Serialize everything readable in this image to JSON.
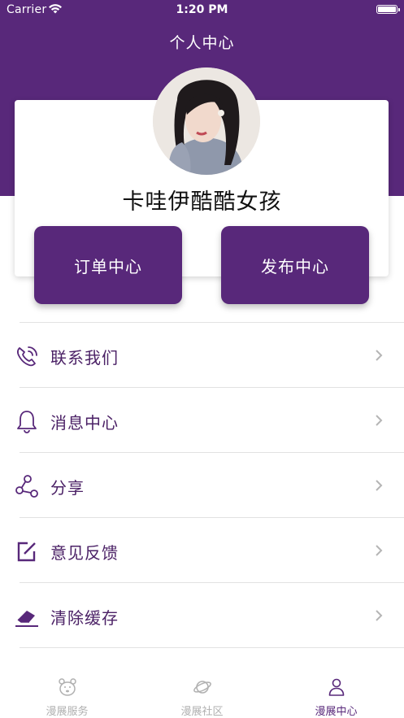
{
  "status_bar": {
    "carrier": "Carrier",
    "time": "1:20 PM"
  },
  "header": {
    "title": "个人中心"
  },
  "profile": {
    "username": "卡哇伊酷酷女孩"
  },
  "actions": {
    "orders": "订单中心",
    "publish": "发布中心"
  },
  "menu": {
    "items": [
      {
        "label": "联系我们",
        "icon": "phone-icon"
      },
      {
        "label": "消息中心",
        "icon": "bell-icon"
      },
      {
        "label": "分享",
        "icon": "share-icon"
      },
      {
        "label": "意见反馈",
        "icon": "feedback-icon"
      },
      {
        "label": "清除缓存",
        "icon": "eraser-icon"
      }
    ]
  },
  "tab_bar": {
    "tabs": [
      {
        "label": "漫展服务",
        "icon": "bear-icon",
        "active": false
      },
      {
        "label": "漫展社区",
        "icon": "planet-icon",
        "active": false
      },
      {
        "label": "漫展中心",
        "icon": "person-icon",
        "active": true
      }
    ]
  },
  "colors": {
    "brand": "#58287a",
    "text": "#4b2166",
    "inactive": "#b0b0b0"
  }
}
